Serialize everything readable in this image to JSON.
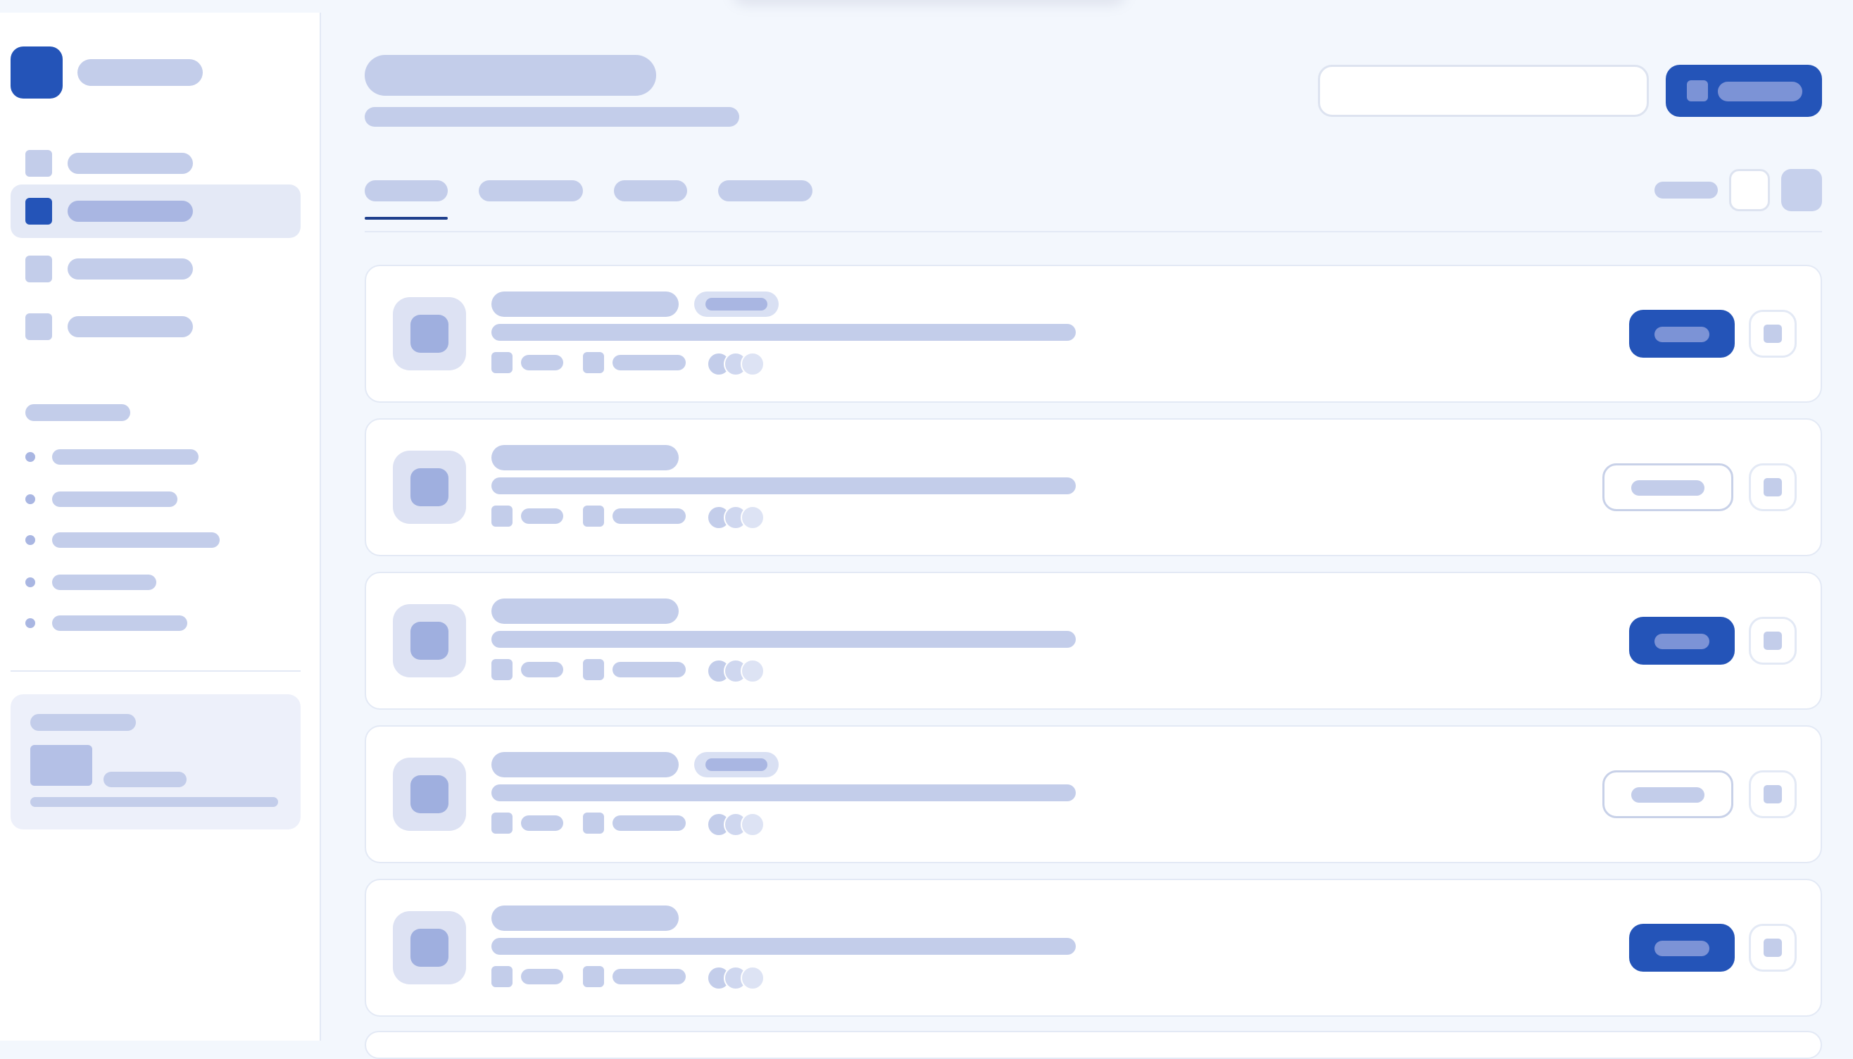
{
  "search": {
    "value": "",
    "placeholder": ""
  },
  "colors": {
    "accent": "#2454b8",
    "placeholder": "#c3cdea",
    "background": "#f3f7fd",
    "surface": "#ffffff",
    "border": "#e3e9f5"
  },
  "sidebar": {
    "nav_items": [
      {
        "state": "default",
        "icon": "nav-item-icon"
      },
      {
        "state": "active",
        "icon": "nav-item-icon"
      },
      {
        "state": "default",
        "icon": "nav-item-icon"
      },
      {
        "state": "default",
        "icon": "nav-item-icon"
      }
    ],
    "sub_items_count": 5
  },
  "tabs": {
    "active_index": 0,
    "count": 4
  },
  "cards": [
    {
      "has_tag": true,
      "action_style": "filled"
    },
    {
      "has_tag": false,
      "action_style": "outline"
    },
    {
      "has_tag": false,
      "action_style": "filled"
    },
    {
      "has_tag": true,
      "action_style": "outline"
    },
    {
      "has_tag": false,
      "action_style": "filled"
    }
  ]
}
